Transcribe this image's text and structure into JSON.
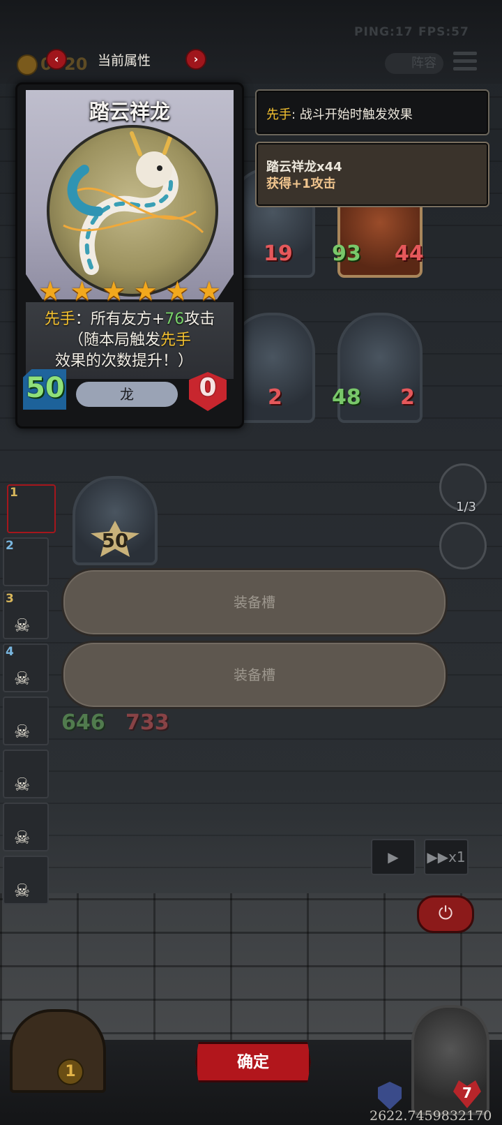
{
  "status": {
    "ping": "PING:17",
    "fps": "FPS:57"
  },
  "topbar": {
    "title": "当前属性",
    "coins_left": "0",
    "coins_right": "20",
    "lineup_label": "阵容"
  },
  "card": {
    "name": "踏云祥龙",
    "stars": 6,
    "desc_line1_prefix": "先手",
    "desc_line1_mid": "：所有友方+",
    "desc_line1_value": "76",
    "desc_line1_suffix": "攻击",
    "desc_line2_prefix": "（随本局触发",
    "desc_line2_keyword": "先手",
    "desc_line3": "效果的次数提升！）",
    "attack": "50",
    "type": "龙",
    "health": "0"
  },
  "tooltip1": {
    "keyword": "先手",
    "text": ": 战斗开始时触发效果"
  },
  "tooltip2": {
    "line1": "踏云祥龙x44",
    "line2": "获得+1攻击"
  },
  "board": {
    "top_row": [
      {
        "atk": "",
        "hp": "19"
      },
      {
        "atk": "93",
        "hp": "44"
      }
    ],
    "mid_row": [
      {
        "atk": "",
        "hp": "2"
      },
      {
        "atk": "48",
        "hp": "2"
      }
    ],
    "selected_minion_cost": "50",
    "ghost_stats": {
      "atk": "646",
      "hp": "733"
    }
  },
  "roster": [
    {
      "num": "1",
      "dead": false
    },
    {
      "num": "2",
      "dead": false
    },
    {
      "num": "3",
      "dead": true
    },
    {
      "num": "4",
      "dead": true
    },
    {
      "num": "",
      "dead": true
    },
    {
      "num": "",
      "dead": true
    },
    {
      "num": "",
      "dead": true
    },
    {
      "num": "",
      "dead": true
    }
  ],
  "equipment": {
    "slot1": "装备槽",
    "slot2": "装备槽"
  },
  "right_panel": {
    "counter": "1/3",
    "speed_label": "▶▶x1"
  },
  "confirm_label": "确定",
  "bottom": {
    "gate_coin": "1",
    "hero_hp": "7",
    "score": "2622.7459832170"
  },
  "colors": {
    "accent_red": "#b2161c",
    "keyword_yellow": "#f5c230",
    "attack_green": "#79d36a"
  }
}
